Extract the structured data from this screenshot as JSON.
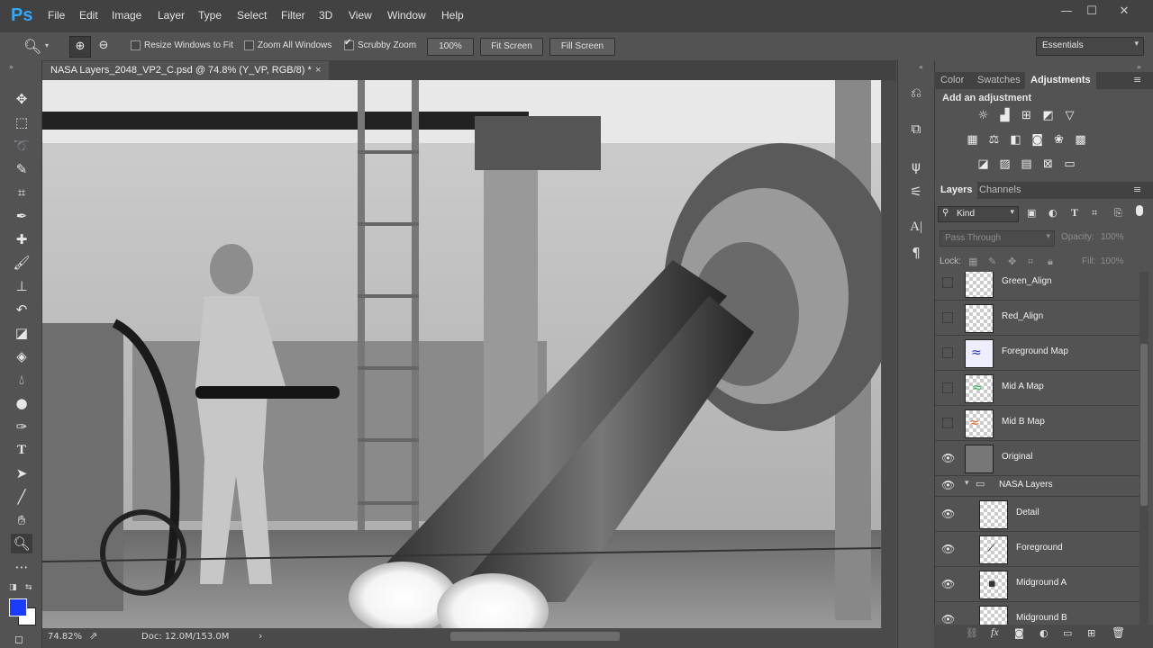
{
  "app": {
    "logo": "Ps"
  },
  "menu": [
    "File",
    "Edit",
    "Image",
    "Layer",
    "Type",
    "Select",
    "Filter",
    "3D",
    "View",
    "Window",
    "Help"
  ],
  "window_controls": {
    "minimize": "—",
    "restore": "☐",
    "close": "✕"
  },
  "options": {
    "resize_windows_label": "Resize Windows to Fit",
    "zoom_all_label": "Zoom All Windows",
    "scrubby_zoom_label": "Scrubby Zoom",
    "zoom_value": "100%",
    "fit_screen": "Fit Screen",
    "fill_screen": "Fill Screen",
    "workspace": "Essentials"
  },
  "document": {
    "tab_title": "NASA Layers_2048_VP2_C.psd @ 74.8% (Y_VP, RGB/8) *",
    "close": "×"
  },
  "status": {
    "zoom": "74.82%",
    "doc": "Doc: 12.0M/153.0M"
  },
  "panels": {
    "top_tabs": [
      "Color",
      "Swatches",
      "Adjustments"
    ],
    "adjustments_title": "Add an adjustment",
    "layers_tabs": [
      "Layers",
      "Channels"
    ],
    "filter_kind": "Kind",
    "blend_mode": "Pass Through",
    "opacity_label": "Opacity:",
    "opacity_value": "100%",
    "lock_label": "Lock:",
    "fill_label": "Fill:",
    "fill_value": "100%"
  },
  "layers": [
    {
      "name": "Green_Align",
      "visible": false
    },
    {
      "name": "Red_Align",
      "visible": false
    },
    {
      "name": "Foreground Map",
      "visible": false
    },
    {
      "name": "Mid A Map",
      "visible": false
    },
    {
      "name": "Mid B Map",
      "visible": false
    },
    {
      "name": "Original",
      "visible": true
    },
    {
      "name": "NASA Layers",
      "visible": true,
      "group": true
    },
    {
      "name": "Detail",
      "visible": true
    },
    {
      "name": "Foreground",
      "visible": true
    },
    {
      "name": "Midground A",
      "visible": true
    },
    {
      "name": "Midground B",
      "visible": true
    }
  ],
  "colors": {
    "accent": "#31a8ff",
    "foreground_swatch": "#1a3cff",
    "background_swatch": "#ffffff"
  }
}
